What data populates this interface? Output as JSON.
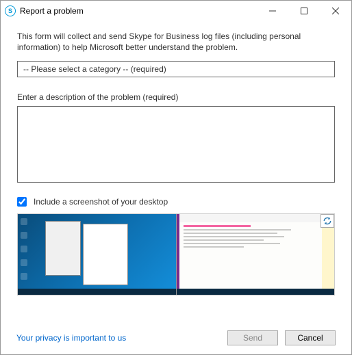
{
  "window": {
    "title": "Report a problem"
  },
  "intro": "This form will collect and send Skype for Business log files (including personal information) to help Microsoft better understand the problem.",
  "category": {
    "placeholder": "-- Please select a category -- (required)"
  },
  "description": {
    "label": "Enter a description of the problem (required)",
    "value": ""
  },
  "screenshot": {
    "label": "Include a screenshot of your desktop",
    "checked": true
  },
  "footer": {
    "privacy": "Your privacy is important to us",
    "send": "Send",
    "cancel": "Cancel"
  }
}
